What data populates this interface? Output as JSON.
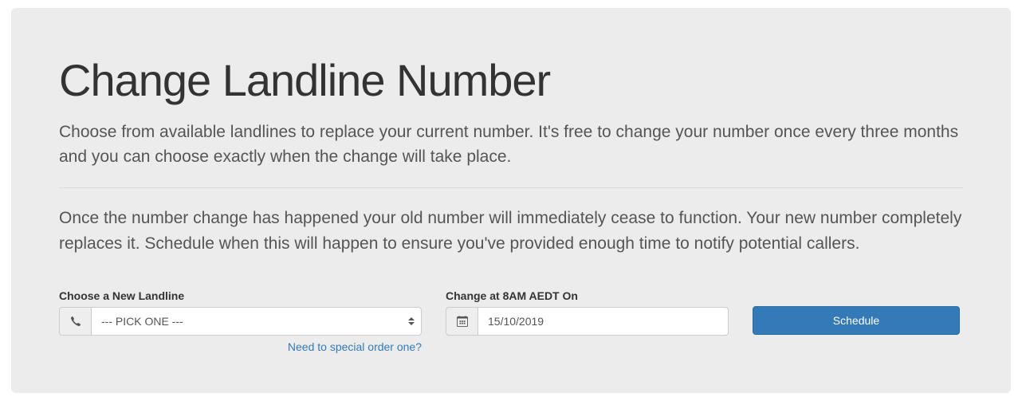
{
  "header": {
    "title": "Change Landline Number",
    "lead": "Choose from available landlines to replace your current number. It's free to change your number once every three months and you can choose exactly when the change will take place."
  },
  "info": "Once the number change has happened your old number will immediately cease to function. Your new number completely replaces it. Schedule when this will happen to ensure you've provided enough time to notify potential callers.",
  "form": {
    "landline": {
      "label": "Choose a New Landline",
      "selected": "--- PICK ONE ---",
      "help_link": "Need to special order one?"
    },
    "date": {
      "label": "Change at 8AM AEDT On",
      "value": "15/10/2019"
    },
    "submit": {
      "label": "Schedule"
    }
  }
}
